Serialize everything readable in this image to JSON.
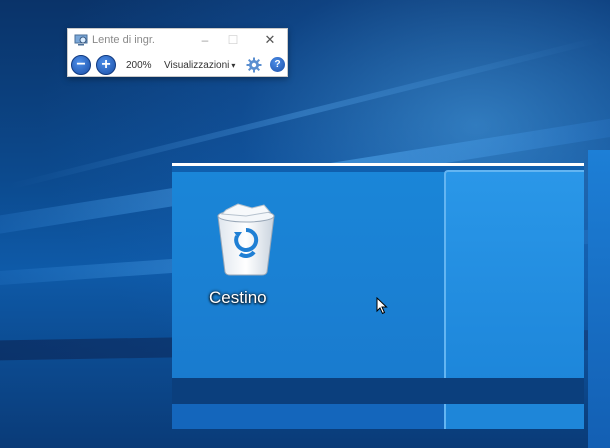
{
  "magnifier": {
    "title": "Lente di ingr.",
    "zoom_out_symbol": "−",
    "zoom_in_symbol": "+",
    "zoom_level": "200%",
    "views_label": "Visualizzazioni",
    "views_caret": "▾",
    "minimize_symbol": "–",
    "maximize_symbol": "☐",
    "close_symbol": "✕",
    "help_symbol": "?",
    "icons": [
      "magnifier-app-icon",
      "zoom-out-icon",
      "zoom-in-icon",
      "gear-icon",
      "help-icon"
    ]
  },
  "desktop": {
    "recycle_bin_label": "Cestino",
    "icons": [
      "recycle-bin-icon",
      "mouse-cursor-icon"
    ]
  },
  "colors": {
    "desktop_blue": "#0c4a8e",
    "lens_blue": "#1a86d8",
    "accent_button_blue": "#1b4fa8"
  }
}
